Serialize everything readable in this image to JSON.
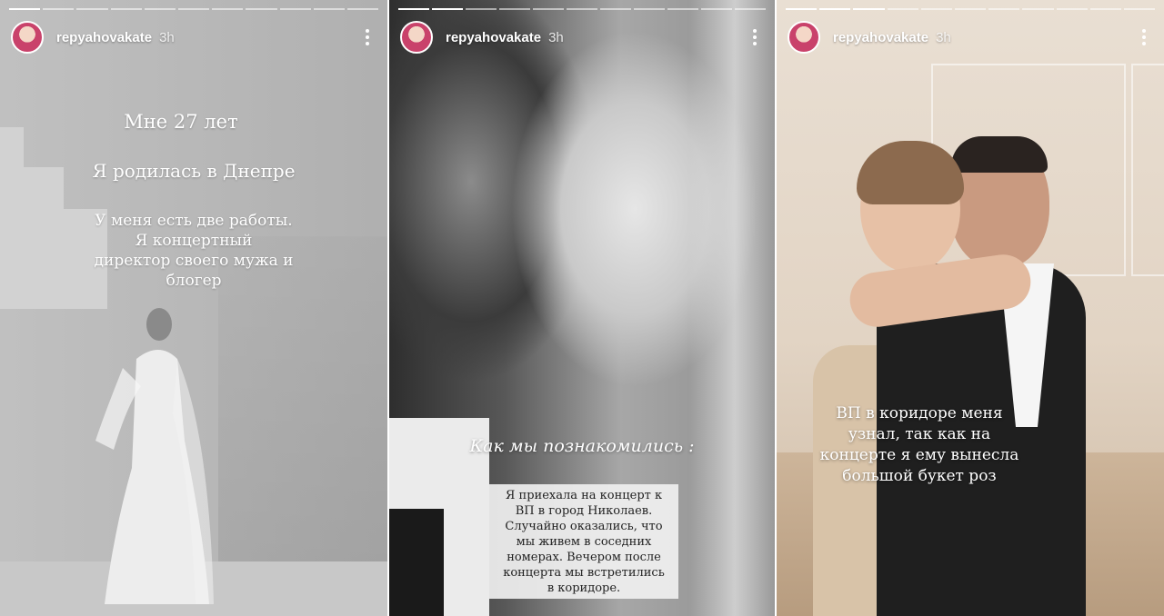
{
  "stories": [
    {
      "user": {
        "username": "repyahovakate",
        "time": "3h"
      },
      "text": {
        "line1": "Мне 27 лет",
        "line2": "Я родилась в Днепре",
        "line3": [
          "У меня есть две работы.",
          "Я концертный",
          "директор своего мужа и",
          "блогер"
        ]
      }
    },
    {
      "user": {
        "username": "repyahovakate",
        "time": "3h"
      },
      "text": {
        "heading": "Как мы познакомились :",
        "box": [
          "Я приехала на концерт к",
          "ВП в город Николаев.",
          "Случайно оказались, что",
          "мы живем в соседних",
          "номерах. Вечером после",
          "концерта мы встретились",
          "в коридоре."
        ]
      }
    },
    {
      "user": {
        "username": "repyahovakate",
        "time": "3h"
      },
      "text": {
        "lines": [
          "ВП в коридоре меня",
          "узнал, так как на",
          "концерте я ему вынесла",
          "большой букет роз"
        ]
      }
    }
  ],
  "colors": {
    "text_primary": "#ffffff",
    "box_bg": "#f0f0f0",
    "box_text": "#222222"
  },
  "icons": {
    "menu": "more-vertical-icon",
    "avatar": "profile-avatar"
  }
}
